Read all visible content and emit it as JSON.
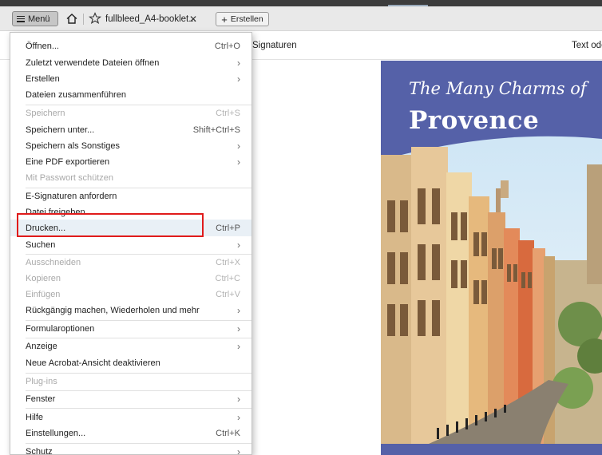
{
  "tabbar": {
    "menu_label": "Menü",
    "tab_title": "fullbleed_A4-booklet...",
    "tab_close": "✕",
    "create_label": "Erstellen"
  },
  "toolbar": {
    "signatures_label": "Signaturen",
    "text_label": "Text ode"
  },
  "document": {
    "title_line1": "The Many Charms of",
    "title_line2": "Provence"
  },
  "menu": {
    "items": [
      {
        "label": "Öffnen...",
        "shortcut": "Ctrl+O",
        "disabled": false
      },
      {
        "label": "Zuletzt verwendete Dateien öffnen",
        "shortcut": "›",
        "disabled": false
      },
      {
        "label": "Erstellen",
        "shortcut": "›",
        "disabled": false
      },
      {
        "label": "Dateien zusammenführen",
        "shortcut": "",
        "disabled": false
      },
      {
        "label": "Speichern",
        "shortcut": "Ctrl+S",
        "disabled": true
      },
      {
        "label": "Speichern unter...",
        "shortcut": "Shift+Ctrl+S",
        "disabled": false
      },
      {
        "label": "Speichern als Sonstiges",
        "shortcut": "›",
        "disabled": false
      },
      {
        "label": "Eine PDF exportieren",
        "shortcut": "›",
        "disabled": false
      },
      {
        "label": "Mit Passwort schützen",
        "shortcut": "",
        "disabled": true
      },
      {
        "label": "E-Signaturen anfordern",
        "shortcut": "",
        "disabled": false
      },
      {
        "label": "Datei freigeben",
        "shortcut": "",
        "disabled": false
      },
      {
        "label": "Drucken...",
        "shortcut": "Ctrl+P",
        "disabled": false
      },
      {
        "label": "Suchen",
        "shortcut": "›",
        "disabled": false
      },
      {
        "label": "Ausschneiden",
        "shortcut": "Ctrl+X",
        "disabled": true
      },
      {
        "label": "Kopieren",
        "shortcut": "Ctrl+C",
        "disabled": true
      },
      {
        "label": "Einfügen",
        "shortcut": "Ctrl+V",
        "disabled": true
      },
      {
        "label": "Rückgängig machen, Wiederholen und mehr",
        "shortcut": "›",
        "disabled": false
      },
      {
        "label": "Formularoptionen",
        "shortcut": "›",
        "disabled": false
      },
      {
        "label": "Anzeige",
        "shortcut": "›",
        "disabled": false
      },
      {
        "label": "Neue Acrobat-Ansicht deaktivieren",
        "shortcut": "",
        "disabled": false
      },
      {
        "label": "Plug-ins",
        "shortcut": "",
        "disabled": true
      },
      {
        "label": "Fenster",
        "shortcut": "›",
        "disabled": false
      },
      {
        "label": "Hilfe",
        "shortcut": "›",
        "disabled": false
      },
      {
        "label": "Einstellungen...",
        "shortcut": "Ctrl+K",
        "disabled": false
      },
      {
        "label": "Schutz",
        "shortcut": "›",
        "disabled": false
      }
    ]
  },
  "colors": {
    "highlight_box": "#e01b1b",
    "page_background": "#5561a8"
  }
}
